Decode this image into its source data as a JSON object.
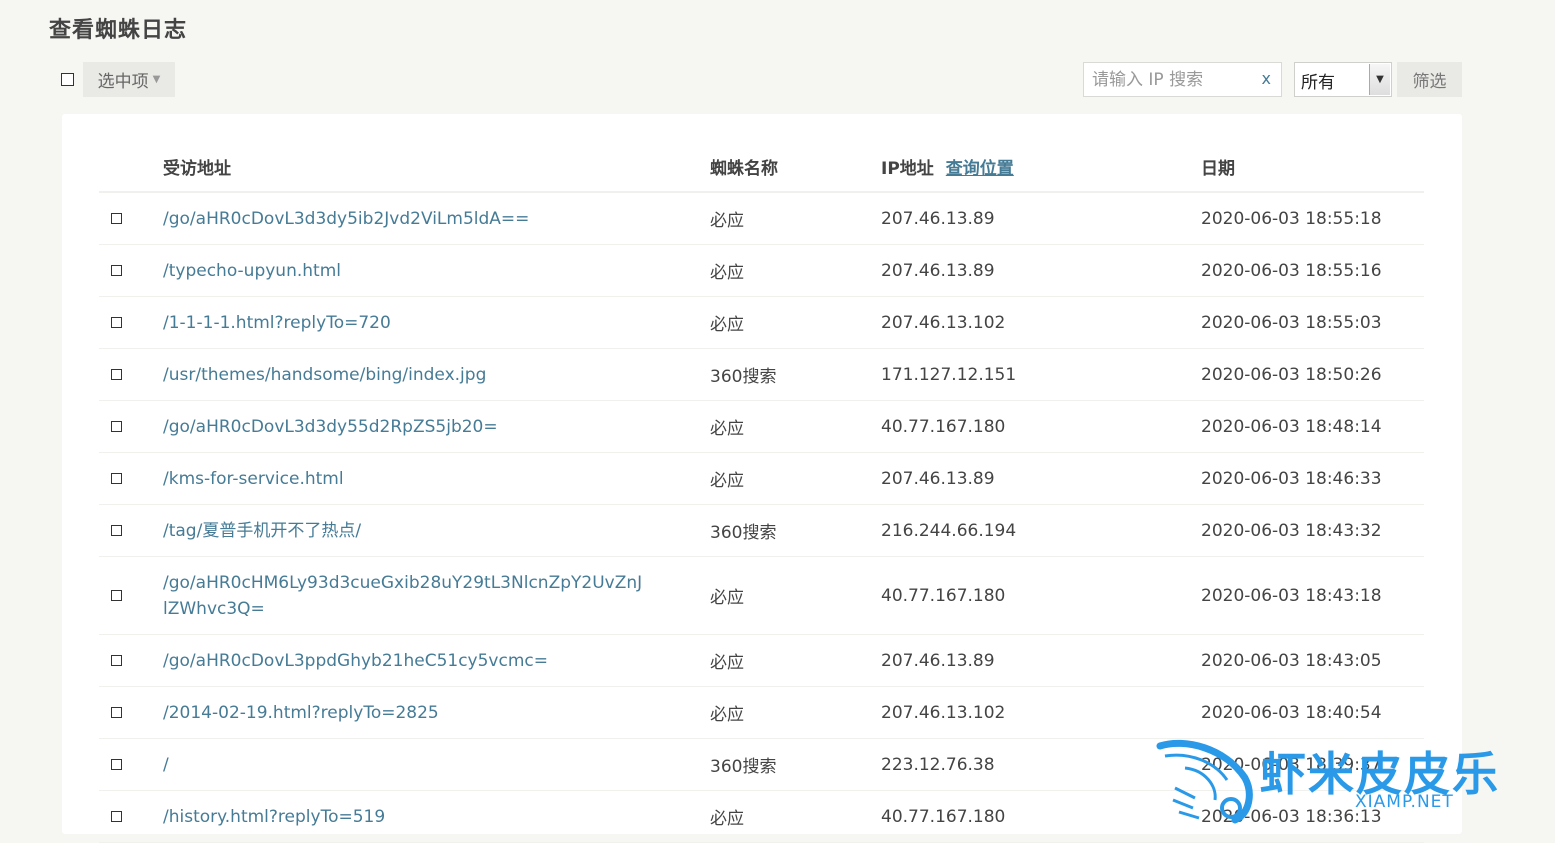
{
  "page": {
    "title": "查看蜘蛛日志"
  },
  "toolbar": {
    "selected_label": "选中项",
    "search_placeholder": "请输入 IP 搜索",
    "clear_label": "x",
    "filter_value": "所有",
    "filter_button": "筛选"
  },
  "table": {
    "columns": [
      "受访地址",
      "蜘蛛名称",
      "IP地址",
      "日期"
    ],
    "locate_link": "查询位置",
    "rows": [
      {
        "url": "/go/aHR0cDovL3d3dy5ib2Jvd2ViLm5ldA==",
        "spider": "必应",
        "ip": "207.46.13.89",
        "date": "2020-06-03 18:55:18"
      },
      {
        "url": "/typecho-upyun.html",
        "spider": "必应",
        "ip": "207.46.13.89",
        "date": "2020-06-03 18:55:16"
      },
      {
        "url": "/1-1-1-1.html?replyTo=720",
        "spider": "必应",
        "ip": "207.46.13.102",
        "date": "2020-06-03 18:55:03"
      },
      {
        "url": "/usr/themes/handsome/bing/index.jpg",
        "spider": "360搜索",
        "ip": "171.127.12.151",
        "date": "2020-06-03 18:50:26"
      },
      {
        "url": "/go/aHR0cDovL3d3dy55d2RpZS5jb20=",
        "spider": "必应",
        "ip": "40.77.167.180",
        "date": "2020-06-03 18:48:14"
      },
      {
        "url": "/kms-for-service.html",
        "spider": "必应",
        "ip": "207.46.13.89",
        "date": "2020-06-03 18:46:33"
      },
      {
        "url": "/tag/夏普手机开不了热点/",
        "spider": "360搜索",
        "ip": "216.244.66.194",
        "date": "2020-06-03 18:43:32"
      },
      {
        "url": "/go/aHR0cHM6Ly93d3cueGxib28uY29tL3NlcnZpY2UvZnJlZWhvc3Q=",
        "spider": "必应",
        "ip": "40.77.167.180",
        "date": "2020-06-03 18:43:18",
        "tall": true
      },
      {
        "url": "/go/aHR0cDovL3ppdGhyb21heC51cy5vcmc=",
        "spider": "必应",
        "ip": "207.46.13.89",
        "date": "2020-06-03 18:43:05"
      },
      {
        "url": "/2014-02-19.html?replyTo=2825",
        "spider": "必应",
        "ip": "207.46.13.102",
        "date": "2020-06-03 18:40:54"
      },
      {
        "url": "/",
        "spider": "360搜索",
        "ip": "223.12.76.38",
        "date": "2020-06-03 18:39:37"
      },
      {
        "url": "/history.html?replyTo=519",
        "spider": "必应",
        "ip": "40.77.167.180",
        "date": "2020-06-03 18:36:13"
      }
    ]
  },
  "watermark": {
    "title": "虾米皮皮乐",
    "subtitle": "XIAMP.NET"
  }
}
